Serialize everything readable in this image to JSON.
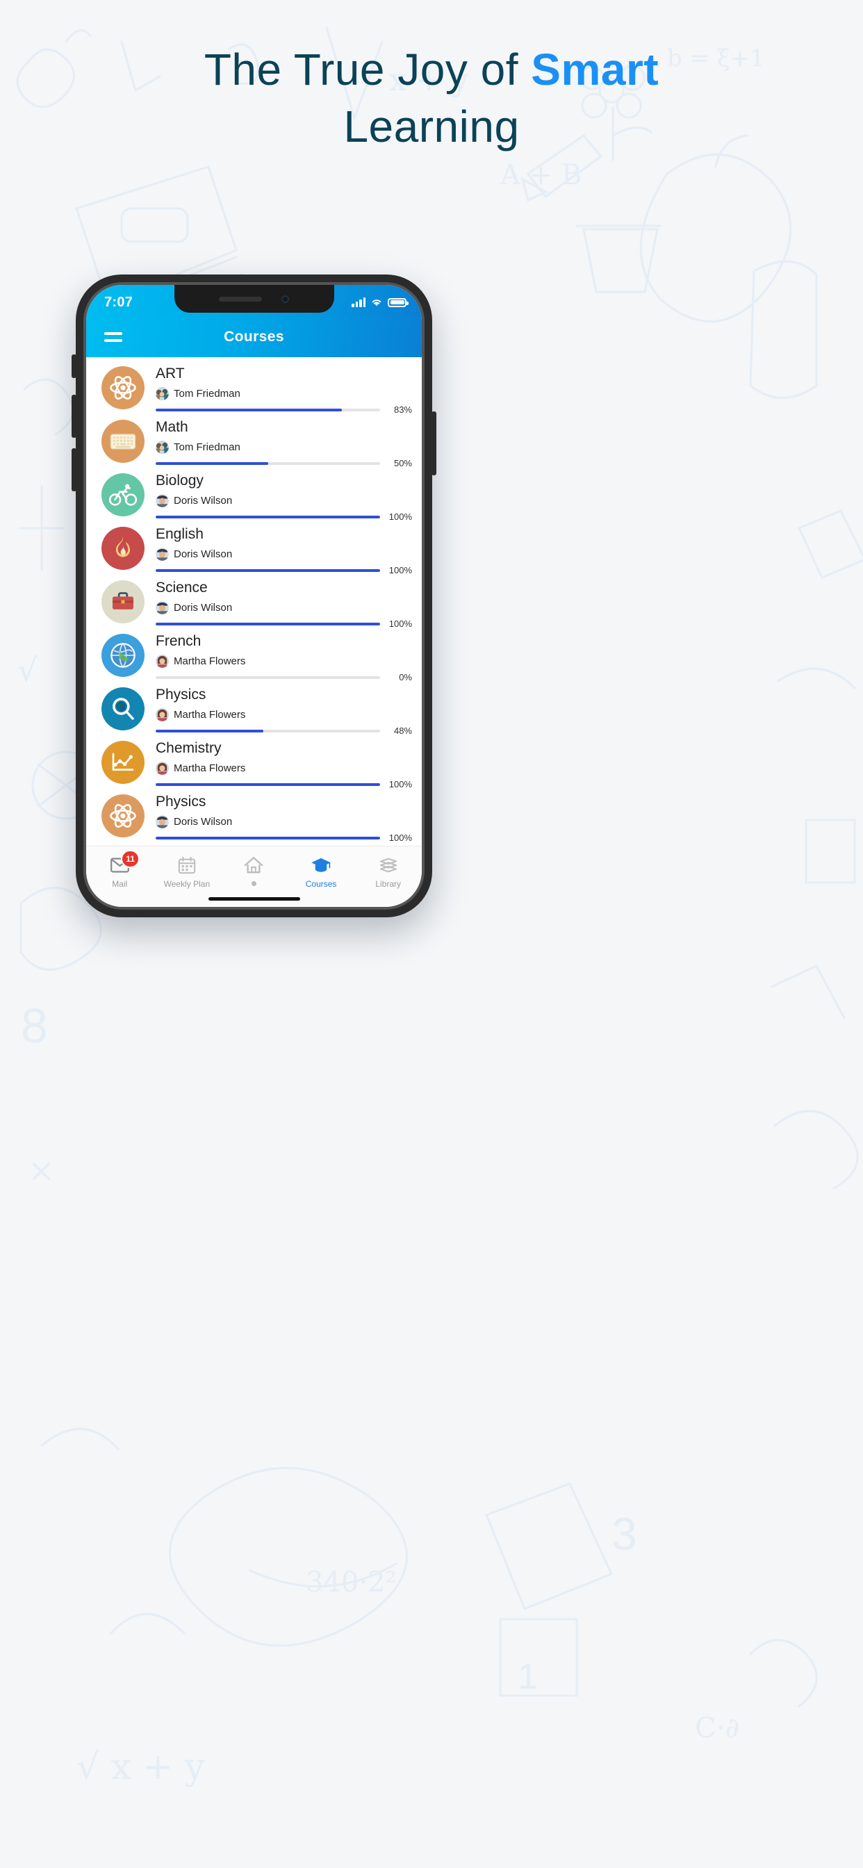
{
  "hero": {
    "line1_pre": "The True Joy of ",
    "line1_accent": "Smart",
    "line2": "Learning",
    "text_color": "#0b4257",
    "accent_color": "#1a90f5"
  },
  "status_bar": {
    "time": "7:07",
    "signal_icon": "signal-bars-icon",
    "wifi_icon": "wifi-icon",
    "battery_icon": "battery-full-icon"
  },
  "app_bar": {
    "title": "Courses",
    "menu_icon": "hamburger-menu-icon",
    "gradient_from": "#00bdf0",
    "gradient_to": "#0a7fd4"
  },
  "progress": {
    "fill_color": "#2f4fd8",
    "track_color": "#e3e3e3"
  },
  "courses": [
    {
      "title": "ART",
      "instructor": "Tom Friedman",
      "percent": 83,
      "percent_label": "83%",
      "icon": "atom-icon",
      "icon_bg": "#dd9a5e"
    },
    {
      "title": "Math",
      "instructor": "Tom Friedman",
      "percent": 50,
      "percent_label": "50%",
      "icon": "keyboard-icon",
      "icon_bg": "#dd9a5e"
    },
    {
      "title": "Biology",
      "instructor": "Doris Wilson",
      "percent": 100,
      "percent_label": "100%",
      "icon": "bicycle-icon",
      "icon_bg": "#63c6a4"
    },
    {
      "title": "English",
      "instructor": "Doris Wilson",
      "percent": 100,
      "percent_label": "100%",
      "icon": "flame-icon",
      "icon_bg": "#c74b4b"
    },
    {
      "title": "Science",
      "instructor": "Doris Wilson",
      "percent": 100,
      "percent_label": "100%",
      "icon": "briefcase-icon",
      "icon_bg": "#dcdcc9"
    },
    {
      "title": "French",
      "instructor": "Martha Flowers",
      "percent": 0,
      "percent_label": "0%",
      "icon": "globe-icon",
      "icon_bg": "#3ba0dd"
    },
    {
      "title": "Physics",
      "instructor": "Martha Flowers",
      "percent": 48,
      "percent_label": "48%",
      "icon": "magnifier-icon",
      "icon_bg": "#1286b0"
    },
    {
      "title": "Chemistry",
      "instructor": "Martha Flowers",
      "percent": 100,
      "percent_label": "100%",
      "icon": "line-chart-icon",
      "icon_bg": "#e09a2b"
    },
    {
      "title": "Physics",
      "instructor": "Doris Wilson",
      "percent": 100,
      "percent_label": "100%",
      "icon": "atom-icon",
      "icon_bg": "#dd9a5e"
    }
  ],
  "bottom_nav": [
    {
      "label": "Mail",
      "icon": "envelope-icon",
      "badge": "11",
      "active": false
    },
    {
      "label": "Weekly Plan",
      "icon": "calendar-icon",
      "badge": "",
      "active": false
    },
    {
      "label": "",
      "icon": "home-icon",
      "badge": "",
      "active": false
    },
    {
      "label": "Courses",
      "icon": "graduation-cap-icon",
      "badge": "",
      "active": true
    },
    {
      "label": "Library",
      "icon": "books-icon",
      "badge": "",
      "active": false
    }
  ]
}
